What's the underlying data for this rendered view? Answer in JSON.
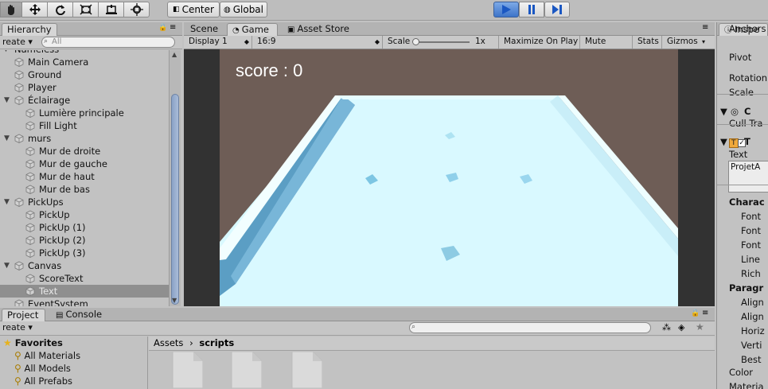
{
  "toolbar": {
    "tools": [
      "hand-tool-icon",
      "move-tool-icon",
      "rotate-tool-icon",
      "scale-tool-icon",
      "rect-tool-icon",
      "transform-tool-icon"
    ],
    "pivot_mode": "Center",
    "pivot_rotation": "Global",
    "play_state": "playing"
  },
  "hierarchy": {
    "tab": "Hierarchy",
    "create_label": "reate",
    "search_placeholder": "All",
    "scene_name": "Nameless",
    "items": [
      {
        "label": "Main Camera",
        "level": 1,
        "fold": false
      },
      {
        "label": "Ground",
        "level": 1,
        "fold": false
      },
      {
        "label": "Player",
        "level": 1,
        "fold": false
      },
      {
        "label": "Éclairage",
        "level": 1,
        "fold": true
      },
      {
        "label": "Lumière principale",
        "level": 2,
        "fold": false
      },
      {
        "label": "Fill Light",
        "level": 2,
        "fold": false
      },
      {
        "label": "murs",
        "level": 1,
        "fold": true
      },
      {
        "label": "Mur de droite",
        "level": 2,
        "fold": false
      },
      {
        "label": "Mur de gauche",
        "level": 2,
        "fold": false
      },
      {
        "label": "Mur de haut",
        "level": 2,
        "fold": false
      },
      {
        "label": "Mur de bas",
        "level": 2,
        "fold": false
      },
      {
        "label": "PickUps",
        "level": 1,
        "fold": true
      },
      {
        "label": "PickUp",
        "level": 2,
        "fold": false
      },
      {
        "label": "PickUp (1)",
        "level": 2,
        "fold": false
      },
      {
        "label": "PickUp (2)",
        "level": 2,
        "fold": false
      },
      {
        "label": "PickUp (3)",
        "level": 2,
        "fold": false
      },
      {
        "label": "Canvas",
        "level": 1,
        "fold": true
      },
      {
        "label": "ScoreText",
        "level": 2,
        "fold": false
      },
      {
        "label": "Text",
        "level": 2,
        "fold": false,
        "selected": true
      },
      {
        "label": "EventSystem",
        "level": 1,
        "fold": false
      }
    ]
  },
  "game": {
    "tabs": [
      {
        "label": "Scene",
        "active": false
      },
      {
        "label": "Game",
        "active": true
      },
      {
        "label": "Asset Store",
        "active": false
      }
    ],
    "display": "Display 1",
    "aspect": "16:9",
    "scale_label": "Scale",
    "scale_value": "1x",
    "maximize_label": "Maximize On Play",
    "mute_label": "Mute Audio",
    "stats_label": "Stats",
    "gizmos_label": "Gizmos",
    "score_text": "score : 0"
  },
  "inspector": {
    "tab": "Inspe",
    "rows": [
      "Anchors",
      "Pivot",
      "Rotation",
      "Scale",
      "C",
      "Cull Tra",
      "T",
      "Text",
      "ProjetA",
      "Charac",
      "Font",
      "Font",
      "Font",
      "Line",
      "Rich",
      "Paragr",
      "Align",
      "Align",
      "Horiz",
      "Verti",
      "Best",
      "Color",
      "Materia"
    ]
  },
  "project": {
    "tabs": [
      {
        "label": "Project",
        "active": true
      },
      {
        "label": "Console",
        "active": false
      }
    ],
    "create_label": "reate",
    "favorites_label": "Favorites",
    "favorites": [
      "All Materials",
      "All Models",
      "All Prefabs"
    ],
    "breadcrumb_root": "Assets",
    "breadcrumb_current": "scripts"
  },
  "colors": {
    "play_active": "#3a7fe0",
    "floor": "#d9f9ff",
    "background": "#6e5d56"
  }
}
